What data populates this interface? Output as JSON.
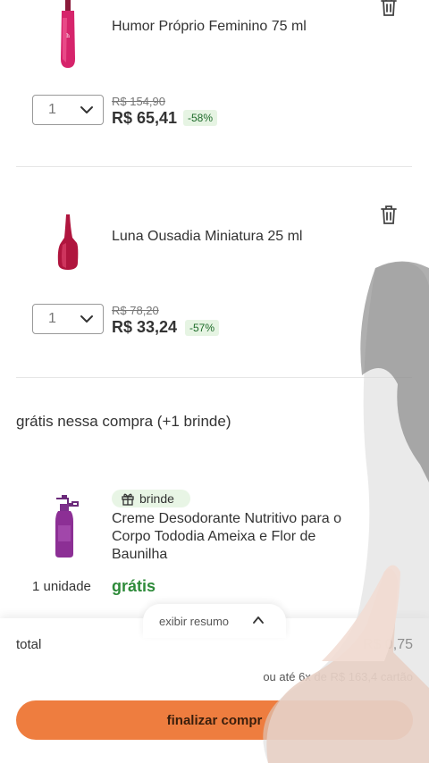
{
  "cart": {
    "items": [
      {
        "name": "Humor Próprio Feminino 75 ml",
        "quantity": "1",
        "old_price": "R$ 154,90",
        "price": "R$ 65,41",
        "discount": "-58%"
      },
      {
        "name": "Luna Ousadia Miniatura 25 ml",
        "quantity": "1",
        "old_price": "R$ 78,20",
        "price": "R$ 33,24",
        "discount": "-57%"
      }
    ],
    "free_section": {
      "title": "grátis nessa compra (+1 brinde)",
      "badge": "brinde",
      "name": "Creme Desodorante Nutritivo para o Corpo Tododia Ameixa e Flor de Baunilha",
      "unit": "1 unidade",
      "price": "grátis"
    }
  },
  "footer": {
    "summary_toggle": "exibir resumo",
    "total_label": "total",
    "total_value": "R$ 0,75",
    "installments": "ou até 6x de R$ 163,4 cartão",
    "cta": "finalizar compr"
  },
  "colors": {
    "cta": "#ee7d3f",
    "discount_bg": "#e6f4e3",
    "free_green": "#2e8b3a"
  },
  "icons": [
    "trash-icon",
    "chevron-down-icon",
    "gift-icon",
    "chevron-up-icon"
  ]
}
